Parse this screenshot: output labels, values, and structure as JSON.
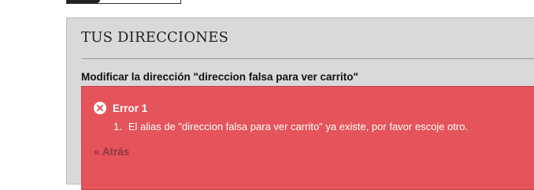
{
  "panel": {
    "title": "TUS DIRECCIONES",
    "subtitle": "Modificar la dirección \"direccion falsa para ver carrito\""
  },
  "alert": {
    "icon": "error-x-icon",
    "title": "Error 1",
    "errors": [
      {
        "number": "1.",
        "text": "El alias de \"direccion falsa para ver carrito\" ya existe, por favor escoje otro."
      }
    ],
    "back_label": "« Atrás",
    "color": "#e4545a"
  }
}
